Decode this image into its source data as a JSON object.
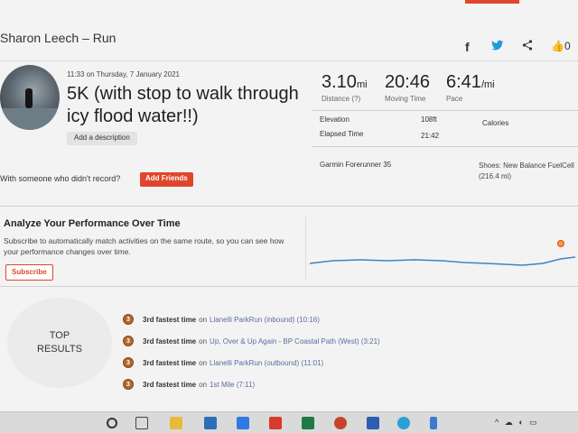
{
  "header": {
    "athlete_activity": "Sharon Leech – Run",
    "share_icons": [
      "facebook-icon",
      "twitter-icon",
      "share-icon",
      "kudos-icon"
    ],
    "kudos_count": "0"
  },
  "activity": {
    "datetime": "11:33 on Thursday, 7 January 2021",
    "title": "5K (with stop to walk through icy flood water!!)",
    "add_description": "Add a description"
  },
  "stats": {
    "distance_value": "3.10",
    "distance_unit": "mi",
    "distance_label": "Distance (?)",
    "moving_time_value": "20:46",
    "moving_time_label": "Moving Time",
    "pace_value": "6:41",
    "pace_unit": "/mi",
    "pace_label": "Pace",
    "elevation_label": "Elevation",
    "elevation_value": "108ft",
    "calories_label": "Calories",
    "elapsed_label": "Elapsed Time",
    "elapsed_value": "21:42",
    "device": "Garmin Forerunner 35",
    "shoes_label": "Shoes: New Balance FuelCell",
    "shoes_mileage": "(216.4 mi)"
  },
  "friends": {
    "prompt": "With someone who didn't record?",
    "button": "Add Friends"
  },
  "analyze": {
    "heading": "Analyze Your Performance Over Time",
    "subtext": "Subscribe to automatically match activities on the same route, so you can see how your performance changes over time.",
    "button": "Subscribe"
  },
  "top_results": {
    "title_line1": "TOP",
    "title_line2": "RESULTS",
    "items": [
      {
        "rank": "3",
        "achievement": "3rd fastest time",
        "on": "on",
        "segment": "Llanelli ParkRun (inbound) (10:16)"
      },
      {
        "rank": "3",
        "achievement": "3rd fastest time",
        "on": "on",
        "segment": "Up, Over & Up Again - BP Coastal Path (West) (3:21)"
      },
      {
        "rank": "3",
        "achievement": "3rd fastest time",
        "on": "on",
        "segment": "Llanelli ParkRun (outbound) (11:01)"
      },
      {
        "rank": "3",
        "achievement": "3rd fastest time",
        "on": "on",
        "segment": "1st Mile (7:11)"
      }
    ]
  },
  "colors": {
    "accent": "#e0462b",
    "chart_line": "#3d84c6",
    "medal": "#b5642a"
  }
}
